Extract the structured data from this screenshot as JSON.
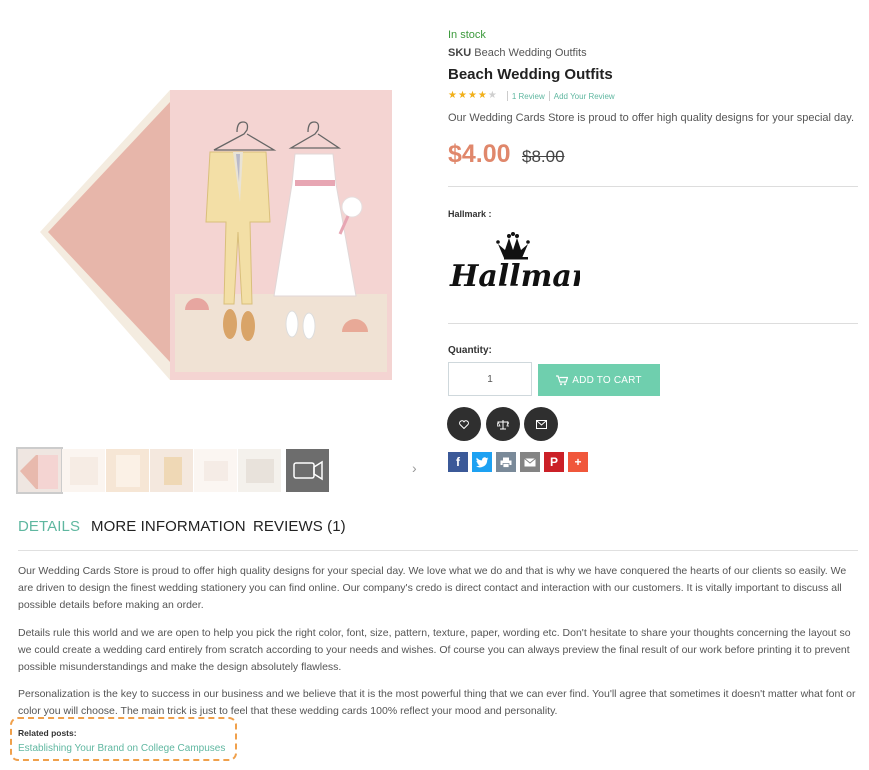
{
  "product": {
    "stock_status": "In stock",
    "sku_label": "SKU",
    "sku_value": "Beach Wedding Outfits",
    "name": "Beach Wedding Outfits",
    "rating_stars": 4,
    "rating_max": 5,
    "reviews_link": "1 Review",
    "add_review_link": "Add Your Review",
    "short_description": "Our Wedding Cards Store is proud to offer high quality designs for your special day.",
    "price": "$4.00",
    "old_price": "$8.00",
    "brand_label": "Hallmark :",
    "brand_logo_text": "Hallmark",
    "quantity_label": "Quantity:",
    "quantity_value": "1",
    "add_to_cart_label": "ADD TO CART"
  },
  "actions": {
    "wishlist_icon": "heart-icon",
    "compare_icon": "scale-icon",
    "email_icon": "envelope-icon"
  },
  "share": [
    "facebook-icon",
    "twitter-icon",
    "print-icon",
    "email-icon",
    "pinterest-icon",
    "plus-icon"
  ],
  "gallery": {
    "thumbnails": 7,
    "active_index": 0
  },
  "tabs": [
    {
      "label": "DETAILS",
      "active": true
    },
    {
      "label": "MORE INFORMATION",
      "active": false
    },
    {
      "label": "REVIEWS (1)",
      "active": false
    }
  ],
  "details": [
    "Our Wedding Cards Store is proud to offer high quality designs for your special day. We love what we do and that is why we have conquered the hearts of our clients so easily. We are driven to design the finest wedding stationery you can find online. Our company's credo is direct contact and interaction with our customers. It is vitally important to discuss all possible details before making an order.",
    "Details rule this world and we are open to help you pick the right color, font, size, pattern, texture, paper, wording etc. Don't hesitate to share your thoughts concerning the layout so we could create a wedding card entirely from scratch according to your needs and wishes. Of course you can always preview the final result of our work before printing it to prevent possible misunderstandings and make the design absolutely flawless.",
    "Personalization is the key to success in our business and we believe that it is the most powerful thing that we can ever find. You'll agree that sometimes it doesn't matter what font or color you will choose. The main trick is just to feel that these wedding cards 100% reflect your mood and personality."
  ],
  "related": {
    "title": "Related posts:",
    "link": "Establishing Your Brand on College Campuses"
  },
  "colors": {
    "accent": "#6fcfae",
    "link": "#5fb7a0",
    "price": "#e0876b",
    "stock": "#3c9a3c",
    "highlight": "#f0a04b"
  }
}
